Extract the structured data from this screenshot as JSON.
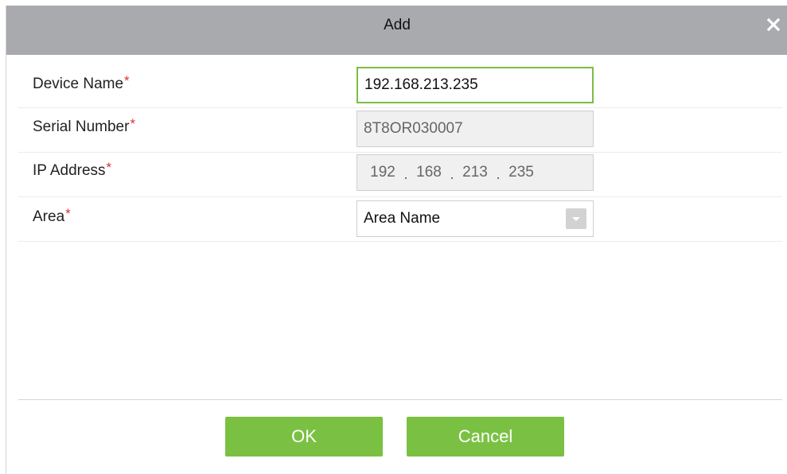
{
  "dialog": {
    "title": "Add",
    "close_icon": "close-icon"
  },
  "form": {
    "device_name": {
      "label": "Device Name",
      "required_mark": "*",
      "value": "192.168.213.235"
    },
    "serial_number": {
      "label": "Serial Number",
      "required_mark": "*",
      "value": "8T8OR030007"
    },
    "ip_address": {
      "label": "IP Address",
      "required_mark": "*",
      "octets": [
        "192",
        "168",
        "213",
        "235"
      ],
      "separator": "."
    },
    "area": {
      "label": "Area",
      "required_mark": "*",
      "selected": "Area Name",
      "arrow_icon": "chevron-down-icon"
    }
  },
  "buttons": {
    "ok_label": "OK",
    "cancel_label": "Cancel"
  },
  "colors": {
    "titlebar": "#a9aaad",
    "accent_green": "#7ac143",
    "focus_border": "#7bbd42",
    "required": "#e0312e"
  }
}
